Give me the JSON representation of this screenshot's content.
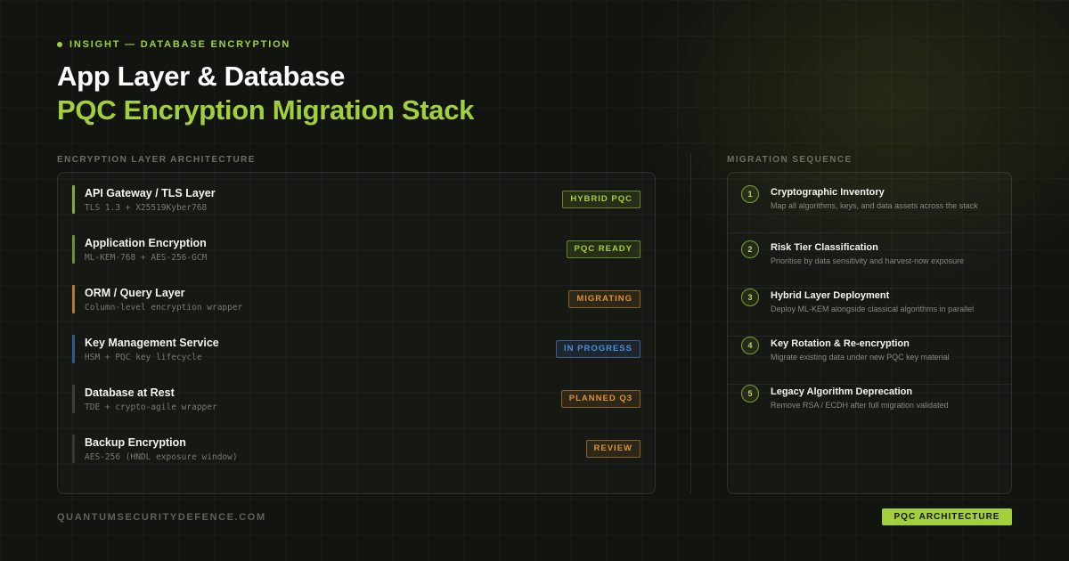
{
  "header": {
    "kicker": "INSIGHT — DATABASE ENCRYPTION",
    "title_line1": "App Layer & Database",
    "title_line2": "PQC Encryption Migration Stack"
  },
  "colors": {
    "accent": "#a3cf3c",
    "background": "#121410",
    "status_green": "#a3cf3c",
    "status_orange": "#d9923a",
    "status_blue": "#4a8fe0",
    "status_neutral": "#3c4038"
  },
  "architecture": {
    "label": "ENCRYPTION LAYER ARCHITECTURE",
    "layers": [
      {
        "name": "API Gateway / TLS Layer",
        "detail": "TLS 1.3 + X25519Kyber768",
        "status": "HYBRID PQC",
        "status_color": "#a3cf3c",
        "bar_color": "#7fa83a"
      },
      {
        "name": "Application Encryption",
        "detail": "ML-KEM-768 + AES-256-GCM",
        "status": "PQC READY",
        "status_color": "#a3cf3c",
        "bar_color": "#6e8e34"
      },
      {
        "name": "ORM / Query Layer",
        "detail": "Column-level encryption wrapper",
        "status": "MIGRATING",
        "status_color": "#d9923a",
        "bar_color": "#b07a30"
      },
      {
        "name": "Key Management Service",
        "detail": "HSM + PQC key lifecycle",
        "status": "IN PROGRESS",
        "status_color": "#4a8fe0",
        "bar_color": "#2f5a8c"
      },
      {
        "name": "Database at Rest",
        "detail": "TDE + crypto-agile wrapper",
        "status": "PLANNED Q3",
        "status_color": "#d9923a",
        "bar_color": "#3c4038"
      },
      {
        "name": "Backup Encryption",
        "detail": "AES-256 (HNDL exposure window)",
        "status": "REVIEW",
        "status_color": "#d9923a",
        "bar_color": "#34372f"
      }
    ]
  },
  "migration": {
    "label": "MIGRATION SEQUENCE",
    "steps": [
      {
        "num": "1",
        "title": "Cryptographic Inventory",
        "desc": "Map all algorithms, keys, and data assets across the stack"
      },
      {
        "num": "2",
        "title": "Risk Tier Classification",
        "desc": "Prioritise by data sensitivity and harvest-now exposure"
      },
      {
        "num": "3",
        "title": "Hybrid Layer Deployment",
        "desc": "Deploy ML-KEM alongside classical algorithms in parallel"
      },
      {
        "num": "4",
        "title": "Key Rotation & Re-encryption",
        "desc": "Migrate existing data under new PQC key material"
      },
      {
        "num": "5",
        "title": "Legacy Algorithm Deprecation",
        "desc": "Remove RSA / ECDH after full migration validated"
      }
    ]
  },
  "footer": {
    "domain": "QUANTUMSECURITYDEFENCE.COM",
    "tag": "PQC ARCHITECTURE"
  }
}
